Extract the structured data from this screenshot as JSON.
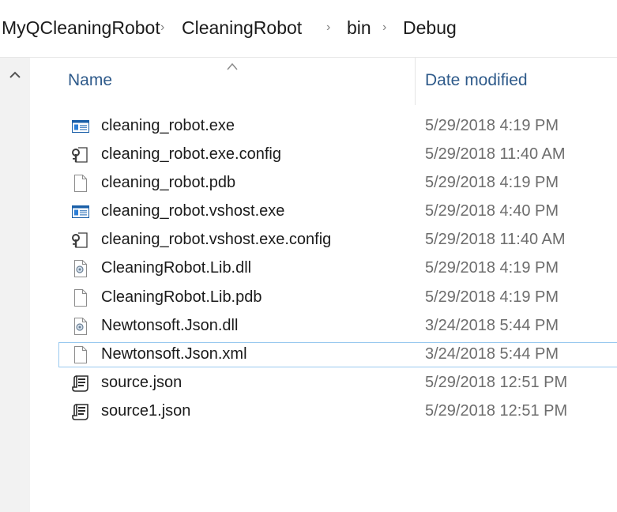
{
  "breadcrumb": {
    "items": [
      "MyQCleaningRobot",
      "CleaningRobot",
      "bin",
      "Debug"
    ],
    "separator": "›"
  },
  "columns": {
    "name": "Name",
    "date_modified": "Date modified",
    "sorted_by": "name"
  },
  "files": [
    {
      "name": "cleaning_robot.exe",
      "date": "5/29/2018 4:19 PM",
      "icon": "exe-icon"
    },
    {
      "name": "cleaning_robot.exe.config",
      "date": "5/29/2018 11:40 AM",
      "icon": "config-icon"
    },
    {
      "name": "cleaning_robot.pdb",
      "date": "5/29/2018 4:19 PM",
      "icon": "blank-file-icon"
    },
    {
      "name": "cleaning_robot.vshost.exe",
      "date": "5/29/2018 4:40 PM",
      "icon": "exe-icon"
    },
    {
      "name": "cleaning_robot.vshost.exe.config",
      "date": "5/29/2018 11:40 AM",
      "icon": "config-icon"
    },
    {
      "name": "CleaningRobot.Lib.dll",
      "date": "5/29/2018 4:19 PM",
      "icon": "dll-icon"
    },
    {
      "name": "CleaningRobot.Lib.pdb",
      "date": "5/29/2018 4:19 PM",
      "icon": "blank-file-icon"
    },
    {
      "name": "Newtonsoft.Json.dll",
      "date": "3/24/2018 5:44 PM",
      "icon": "dll-icon"
    },
    {
      "name": "Newtonsoft.Json.xml",
      "date": "3/24/2018 5:44 PM",
      "icon": "blank-file-icon",
      "focused": true
    },
    {
      "name": "source.json",
      "date": "5/29/2018 12:51 PM",
      "icon": "json-script-icon"
    },
    {
      "name": "source1.json",
      "date": "5/29/2018 12:51 PM",
      "icon": "json-script-icon"
    }
  ],
  "colors": {
    "header_text": "#2e5a8a",
    "focus_border": "#99c9ef",
    "left_pane_bg": "#f2f2f2"
  }
}
